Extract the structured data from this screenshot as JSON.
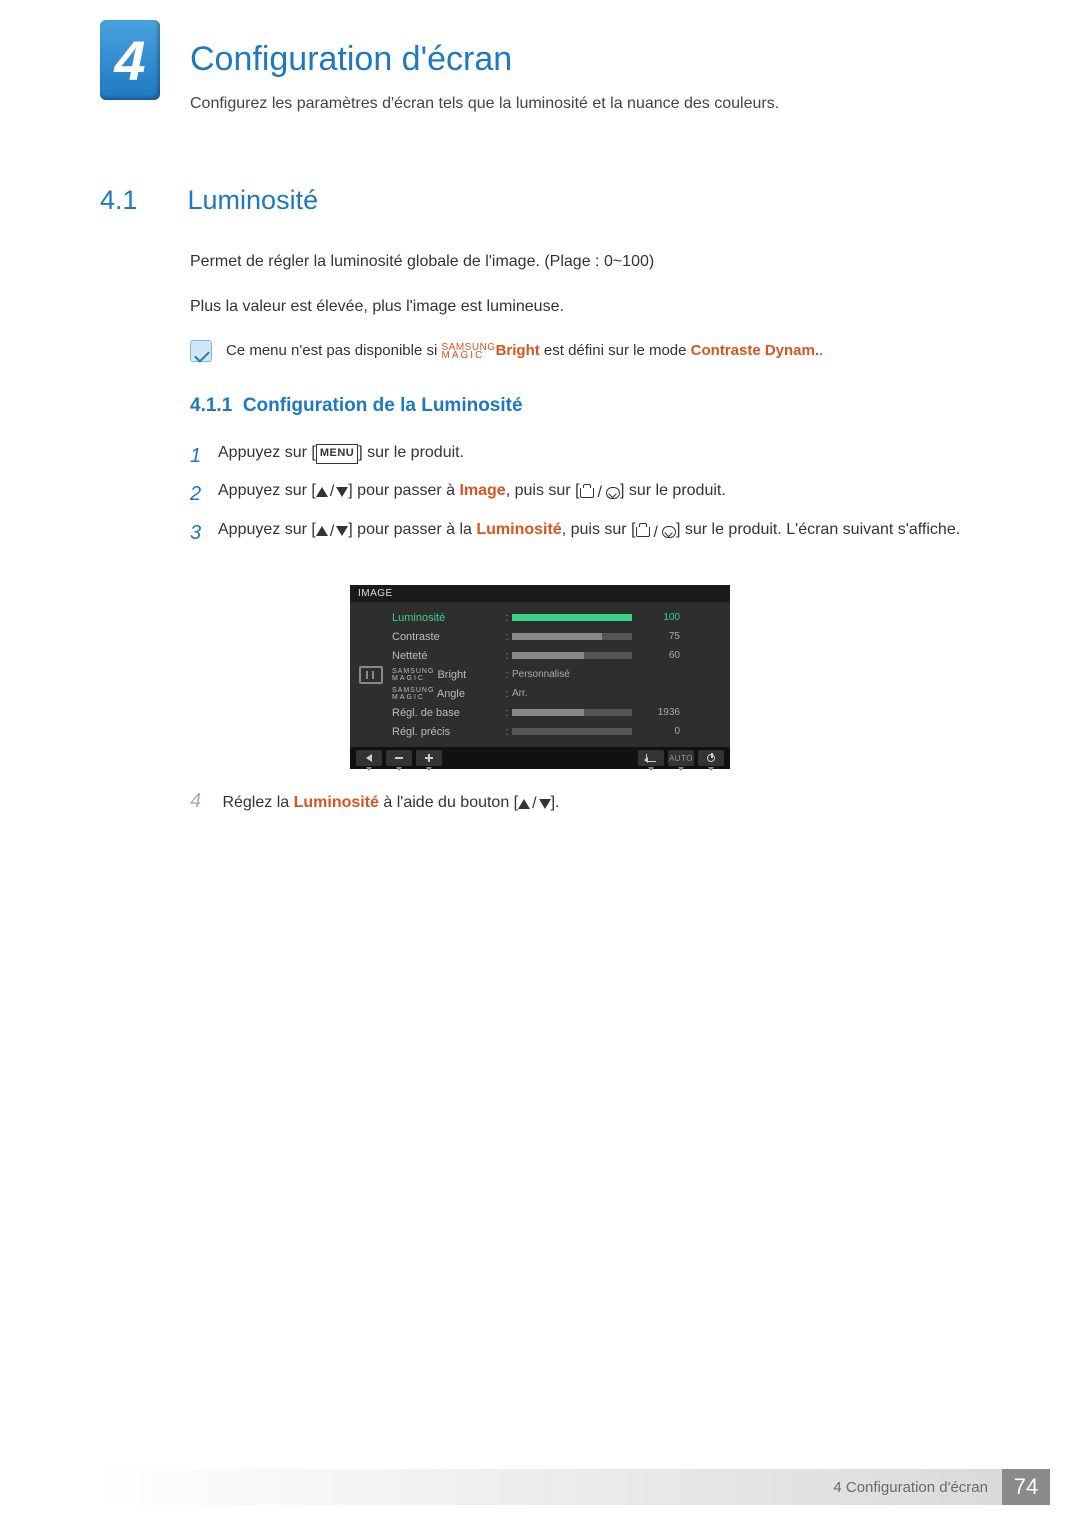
{
  "chapter": {
    "number": "4",
    "title": "Configuration d'écran",
    "description": "Configurez les paramètres d'écran tels que la luminosité et la nuance des couleurs."
  },
  "section": {
    "number": "4.1",
    "title": "Luminosité",
    "p1": "Permet de régler la luminosité globale de l'image. (Plage : 0~100)",
    "p2": "Plus la valeur est élevée, plus l'image est lumineuse."
  },
  "note": {
    "pre": "Ce menu n'est pas disponible si ",
    "magic_top": "SAMSUNG",
    "magic_bottom": "MAGIC",
    "bright": "Bright",
    "mid": " est défini sur le mode ",
    "mode": "Contraste Dynam.",
    "suffix": "."
  },
  "subsection": {
    "number": "4.1.1",
    "title": "Configuration de la Luminosité"
  },
  "steps": {
    "s1": {
      "num": "1",
      "a": "Appuyez sur [",
      "menu": "MENU",
      "b": "] sur le produit."
    },
    "s2": {
      "num": "2",
      "a": "Appuyez sur [",
      "b": "] pour passer à ",
      "image": "Image",
      "c": ", puis sur [",
      "d": "] sur le produit."
    },
    "s3": {
      "num": "3",
      "a": "Appuyez sur [",
      "b": "] pour passer à la ",
      "lum": "Luminosité",
      "c": ", puis sur [",
      "d": "] sur le produit. L'écran suivant s'affiche."
    },
    "s4": {
      "num": "4",
      "a": "Réglez la ",
      "lum": "Luminosité",
      "b": " à l'aide du bouton [",
      "c": "]."
    }
  },
  "osd": {
    "title": "IMAGE",
    "rows": {
      "luminosite": {
        "label": "Luminosité",
        "value": "100",
        "fill": 100
      },
      "contraste": {
        "label": "Contraste",
        "value": "75",
        "fill": 75
      },
      "nettete": {
        "label": "Netteté",
        "value": "60",
        "fill": 60
      },
      "magic_bright": {
        "magic_top": "SAMSUNG",
        "magic_bottom": "MAGIC",
        "suffix": " Bright",
        "text": "Personnalisé"
      },
      "magic_angle": {
        "magic_top": "SAMSUNG",
        "magic_bottom": "MAGIC",
        "suffix": " Angle",
        "text": "Arr."
      },
      "regl_base": {
        "label": "Régl. de base",
        "value": "1936",
        "fill": 60
      },
      "regl_precis": {
        "label": "Régl. précis",
        "value": "0",
        "fill": 0
      }
    },
    "footer_auto": "AUTO"
  },
  "footer": {
    "text": "4 Configuration d'écran",
    "page": "74"
  }
}
